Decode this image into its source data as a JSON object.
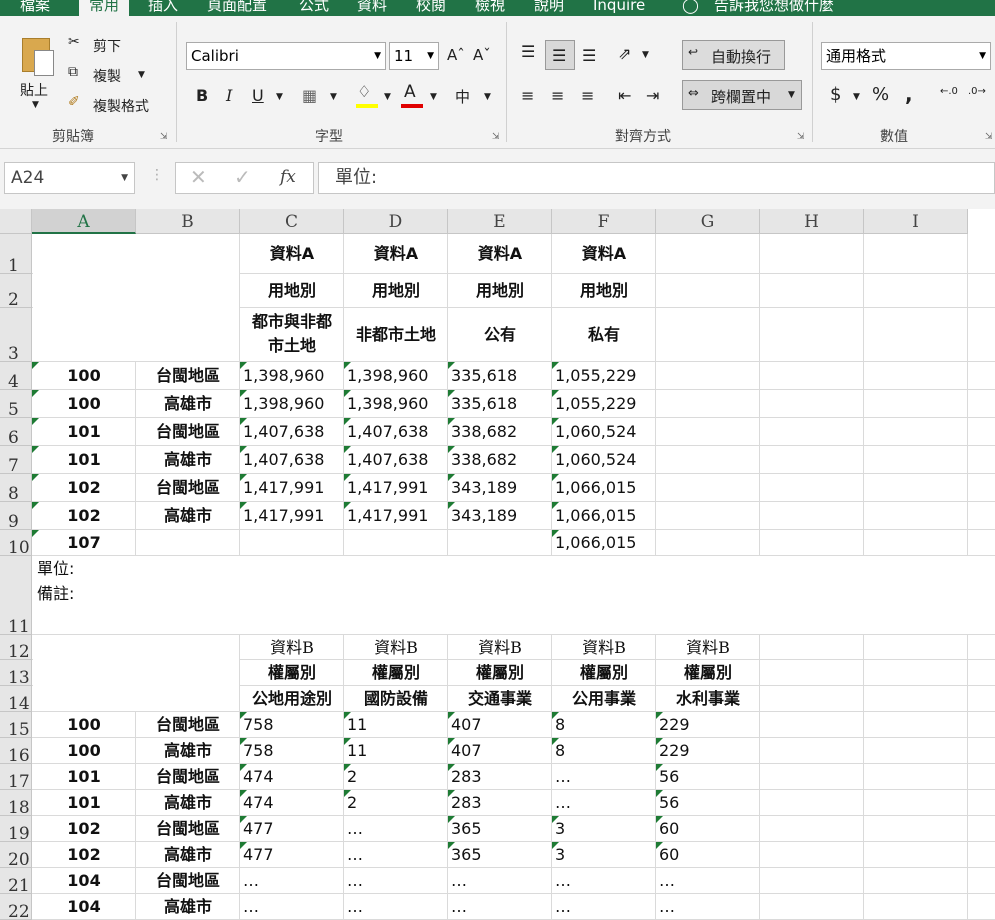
{
  "tabs": [
    "檔案",
    "常用",
    "插入",
    "頁面配置",
    "公式",
    "資料",
    "校閱",
    "檢視",
    "說明",
    "Inquire",
    "告訴我您想做什麼"
  ],
  "ribbon": {
    "clipboard": {
      "paste": "貼上",
      "cut": "剪下",
      "copy": "複製",
      "format_painter": "複製格式",
      "label": "剪貼簿"
    },
    "font": {
      "name": "Calibri",
      "size": "11",
      "bold": "B",
      "italic": "I",
      "underline": "U",
      "label": "字型"
    },
    "alignment": {
      "wrap": "自動換行",
      "merge": "跨欄置中",
      "label": "對齊方式"
    },
    "number": {
      "format": "通用格式",
      "currency": "$",
      "percent": "%",
      "comma": ",",
      "label": "數值"
    }
  },
  "formula_bar": {
    "name_box": "A24",
    "fx": "fx",
    "content": "單位:"
  },
  "columns": [
    "A",
    "B",
    "C",
    "D",
    "E",
    "F",
    "G",
    "H",
    "I"
  ],
  "rows": [
    "1",
    "2",
    "3",
    "4",
    "5",
    "6",
    "7",
    "8",
    "9",
    "10",
    "11",
    "12",
    "13",
    "14",
    "15",
    "16",
    "17",
    "18",
    "19",
    "20",
    "21",
    "22"
  ],
  "tableA": {
    "header1": [
      "資料A",
      "資料A",
      "資料A",
      "資料A"
    ],
    "header2": [
      "用地別",
      "用地別",
      "用地別",
      "用地別"
    ],
    "header3": [
      "都市與非都\n市土地",
      "非都市土地",
      "公有",
      "私有"
    ],
    "rows": [
      [
        "100",
        "台閩地區",
        "1,398,960",
        "1,398,960",
        "335,618",
        "1,055,229"
      ],
      [
        "100",
        "高雄市",
        "1,398,960",
        "1,398,960",
        "335,618",
        "1,055,229"
      ],
      [
        "101",
        "台閩地區",
        "1,407,638",
        "1,407,638",
        "338,682",
        "1,060,524"
      ],
      [
        "101",
        "高雄市",
        "1,407,638",
        "1,407,638",
        "338,682",
        "1,060,524"
      ],
      [
        "102",
        "台閩地區",
        "1,417,991",
        "1,417,991",
        "343,189",
        "1,066,015"
      ],
      [
        "102",
        "高雄市",
        "1,417,991",
        "1,417,991",
        "343,189",
        "1,066,015"
      ],
      [
        "107",
        "",
        "",
        "",
        "",
        "1,066,015"
      ]
    ]
  },
  "notes": {
    "unit": "單位:",
    "remark": "備註:"
  },
  "tableB": {
    "header1": [
      "資料B",
      "資料B",
      "資料B",
      "資料B",
      "資料B"
    ],
    "header2": [
      "權屬別",
      "權屬別",
      "權屬別",
      "權屬別",
      "權屬別"
    ],
    "header3": [
      "公地用途別",
      "國防設備",
      "交通事業",
      "公用事業",
      "水利事業"
    ],
    "rows": [
      [
        "100",
        "台閩地區",
        "758",
        "11",
        "407",
        "8",
        "229"
      ],
      [
        "100",
        "高雄市",
        "758",
        "11",
        "407",
        "8",
        "229"
      ],
      [
        "101",
        "台閩地區",
        "474",
        "2",
        "283",
        "…",
        "56"
      ],
      [
        "101",
        "高雄市",
        "474",
        "2",
        "283",
        "…",
        "56"
      ],
      [
        "102",
        "台閩地區",
        "477",
        "…",
        "365",
        "3",
        "60"
      ],
      [
        "102",
        "高雄市",
        "477",
        "…",
        "365",
        "3",
        "60"
      ],
      [
        "104",
        "台閩地區",
        "…",
        "…",
        "…",
        "…",
        "…"
      ],
      [
        "104",
        "高雄市",
        "…",
        "…",
        "…",
        "…",
        "…"
      ]
    ]
  }
}
